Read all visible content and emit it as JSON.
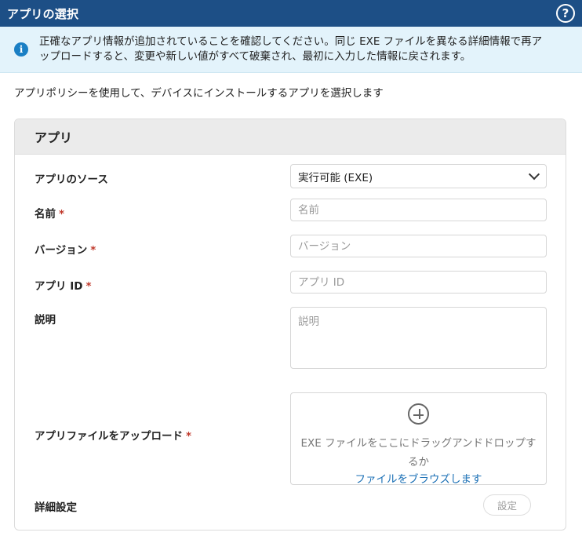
{
  "header": {
    "title": "アプリの選択",
    "help_label": "?"
  },
  "banner": {
    "icon": "info-icon",
    "line1": "正確なアプリ情報が追加されていることを確認してください。同じ EXE ファイルを異なる詳細情報で再ア",
    "line2": "ップロードすると、変更や新しい値がすべて破棄され、最初に入力した情報に戻されます。"
  },
  "intro": "アプリポリシーを使用して、デバイスにインストールするアプリを選択します",
  "card": {
    "title": "アプリ",
    "source": {
      "label": "アプリのソース",
      "value": "実行可能 (EXE)"
    },
    "name": {
      "label": "名前",
      "placeholder": "名前"
    },
    "version": {
      "label": "バージョン",
      "placeholder": "バージョン"
    },
    "app_id": {
      "label": "アプリ ID",
      "placeholder": "アプリ ID"
    },
    "description": {
      "label": "説明",
      "placeholder": "説明"
    },
    "upload": {
      "label": "アプリファイルをアップロード",
      "line1": "EXE ファイルをここにドラッグアンドドロップす",
      "line2": "るか",
      "browse": "ファイルをブラウズします"
    },
    "advanced": {
      "label": "詳細設定",
      "button": "設定"
    },
    "required_mark": "*"
  }
}
